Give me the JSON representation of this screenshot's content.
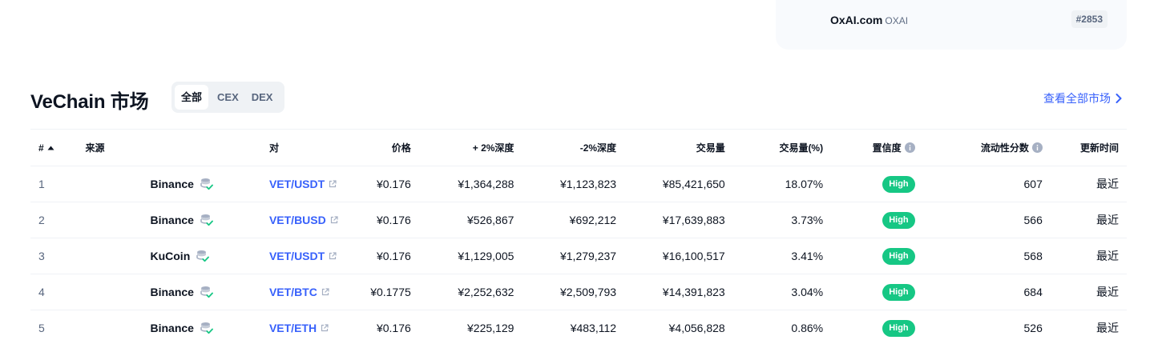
{
  "trending_card": {
    "coin_name": "OxAI.com",
    "coin_symbol": "OXAI",
    "rank": "#2853"
  },
  "section": {
    "title": "VeChain 市场",
    "tabs": [
      {
        "label": "全部",
        "active": true
      },
      {
        "label": "CEX",
        "active": false
      },
      {
        "label": "DEX",
        "active": false
      }
    ],
    "view_all": "查看全部市场"
  },
  "table": {
    "headers": {
      "rank": "#",
      "exchange": "来源",
      "pair": "对",
      "price": "价格",
      "plus_depth": "+ 2%深度",
      "minus_depth": "-2%深度",
      "volume": "交易量",
      "volume_pct": "交易量(%)",
      "confidence": "置信度",
      "liquidity": "流动性分数",
      "updated": "更新时间"
    },
    "rows": [
      {
        "rank": "1",
        "exchange": "Binance",
        "pair": "VET/USDT",
        "price": "¥0.176",
        "plus_depth": "¥1,364,288",
        "minus_depth": "¥1,123,823",
        "volume": "¥85,421,650",
        "volume_pct": "18.07%",
        "confidence": "High",
        "liquidity": "607",
        "updated": "最近"
      },
      {
        "rank": "2",
        "exchange": "Binance",
        "pair": "VET/BUSD",
        "price": "¥0.176",
        "plus_depth": "¥526,867",
        "minus_depth": "¥692,212",
        "volume": "¥17,639,883",
        "volume_pct": "3.73%",
        "confidence": "High",
        "liquidity": "566",
        "updated": "最近"
      },
      {
        "rank": "3",
        "exchange": "KuCoin",
        "pair": "VET/USDT",
        "price": "¥0.176",
        "plus_depth": "¥1,129,005",
        "minus_depth": "¥1,279,237",
        "volume": "¥16,100,517",
        "volume_pct": "3.41%",
        "confidence": "High",
        "liquidity": "568",
        "updated": "最近"
      },
      {
        "rank": "4",
        "exchange": "Binance",
        "pair": "VET/BTC",
        "price": "¥0.1775",
        "plus_depth": "¥2,252,632",
        "minus_depth": "¥2,509,793",
        "volume": "¥14,391,823",
        "volume_pct": "3.04%",
        "confidence": "High",
        "liquidity": "684",
        "updated": "最近"
      },
      {
        "rank": "5",
        "exchange": "Binance",
        "pair": "VET/ETH",
        "price": "¥0.176",
        "plus_depth": "¥225,129",
        "minus_depth": "¥483,112",
        "volume": "¥4,056,828",
        "volume_pct": "0.86%",
        "confidence": "High",
        "liquidity": "526",
        "updated": "最近"
      }
    ]
  },
  "colors": {
    "accent": "#3861fb",
    "high": "#16c784",
    "text": "#0d1421",
    "muted": "#58667e"
  },
  "icons": [
    "sort-up-icon",
    "info-icon",
    "verified-exchange-icon",
    "external-link-icon",
    "chevron-right-icon"
  ]
}
